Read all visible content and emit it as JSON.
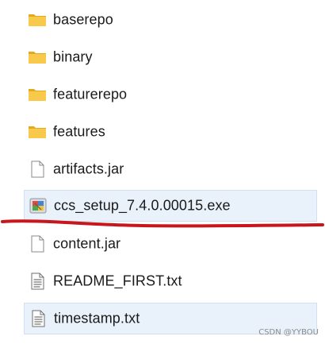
{
  "files": [
    {
      "name": "baserepo",
      "type": "folder",
      "selected": false,
      "icon": "folder-icon"
    },
    {
      "name": "binary",
      "type": "folder",
      "selected": false,
      "icon": "folder-icon"
    },
    {
      "name": "featurerepo",
      "type": "folder",
      "selected": false,
      "icon": "folder-icon"
    },
    {
      "name": "features",
      "type": "folder",
      "selected": false,
      "icon": "folder-icon"
    },
    {
      "name": "artifacts.jar",
      "type": "file",
      "selected": false,
      "icon": "blank-file-icon"
    },
    {
      "name": "ccs_setup_7.4.0.00015.exe",
      "type": "exe",
      "selected": true,
      "icon": "installer-icon"
    },
    {
      "name": "content.jar",
      "type": "file",
      "selected": false,
      "icon": "blank-file-icon"
    },
    {
      "name": "README_FIRST.txt",
      "type": "text",
      "selected": false,
      "icon": "text-file-icon"
    },
    {
      "name": "timestamp.txt",
      "type": "text",
      "selected": true,
      "icon": "text-file-icon"
    }
  ],
  "watermark": "CSDN @YYBOU",
  "colors": {
    "folder_yellow": "#f8c94a",
    "selection_bg": "#e9f2fb",
    "annotation_red": "#c8161d"
  }
}
